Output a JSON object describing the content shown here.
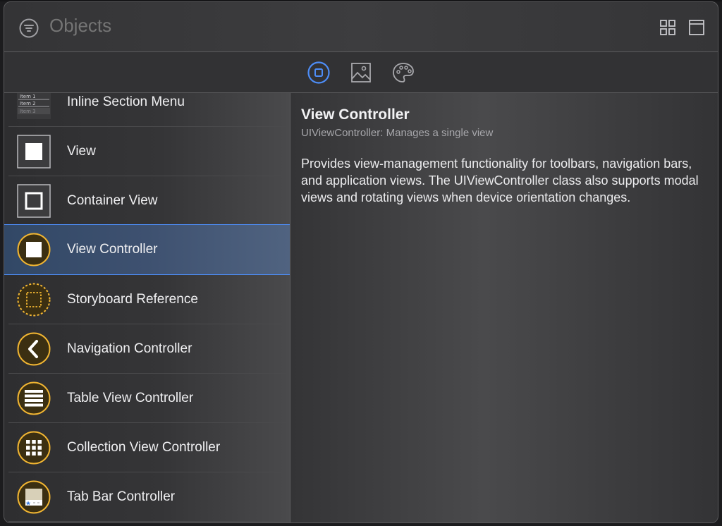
{
  "header": {
    "search_placeholder": "Objects",
    "filter_icon": "filter-icon",
    "grid_view_icon": "grid-view-icon",
    "list_view_icon": "list-view-icon"
  },
  "library_tabs": [
    {
      "icon": "objects-library-icon",
      "selected": true
    },
    {
      "icon": "media-library-icon",
      "selected": false
    },
    {
      "icon": "color-palette-icon",
      "selected": false
    }
  ],
  "list": {
    "items": [
      {
        "label": "Inline Section Menu",
        "icon": "inline-section-menu-icon",
        "menu_lines": [
          "Item 1",
          "Item 2",
          "Item 3"
        ]
      },
      {
        "label": "View",
        "icon": "view-icon"
      },
      {
        "label": "Container View",
        "icon": "container-view-icon"
      },
      {
        "label": "View Controller",
        "icon": "view-controller-icon",
        "selected": true
      },
      {
        "label": "Storyboard Reference",
        "icon": "storyboard-reference-icon"
      },
      {
        "label": "Navigation Controller",
        "icon": "navigation-controller-icon"
      },
      {
        "label": "Table View Controller",
        "icon": "table-view-controller-icon"
      },
      {
        "label": "Collection View Controller",
        "icon": "collection-view-controller-icon"
      },
      {
        "label": "Tab Bar Controller",
        "icon": "tab-bar-controller-icon"
      }
    ]
  },
  "detail": {
    "title": "View Controller",
    "subtitle": "UIViewController: Manages a single view",
    "description": "Provides view-management functionality for toolbars, navigation bars, and application views. The UIViewController class also supports modal views and rotating views when device orientation changes."
  },
  "colors": {
    "accent": "#4d8df7",
    "controller_icon_fill": "#3b2f12",
    "controller_icon_ring": "#f2b632"
  }
}
